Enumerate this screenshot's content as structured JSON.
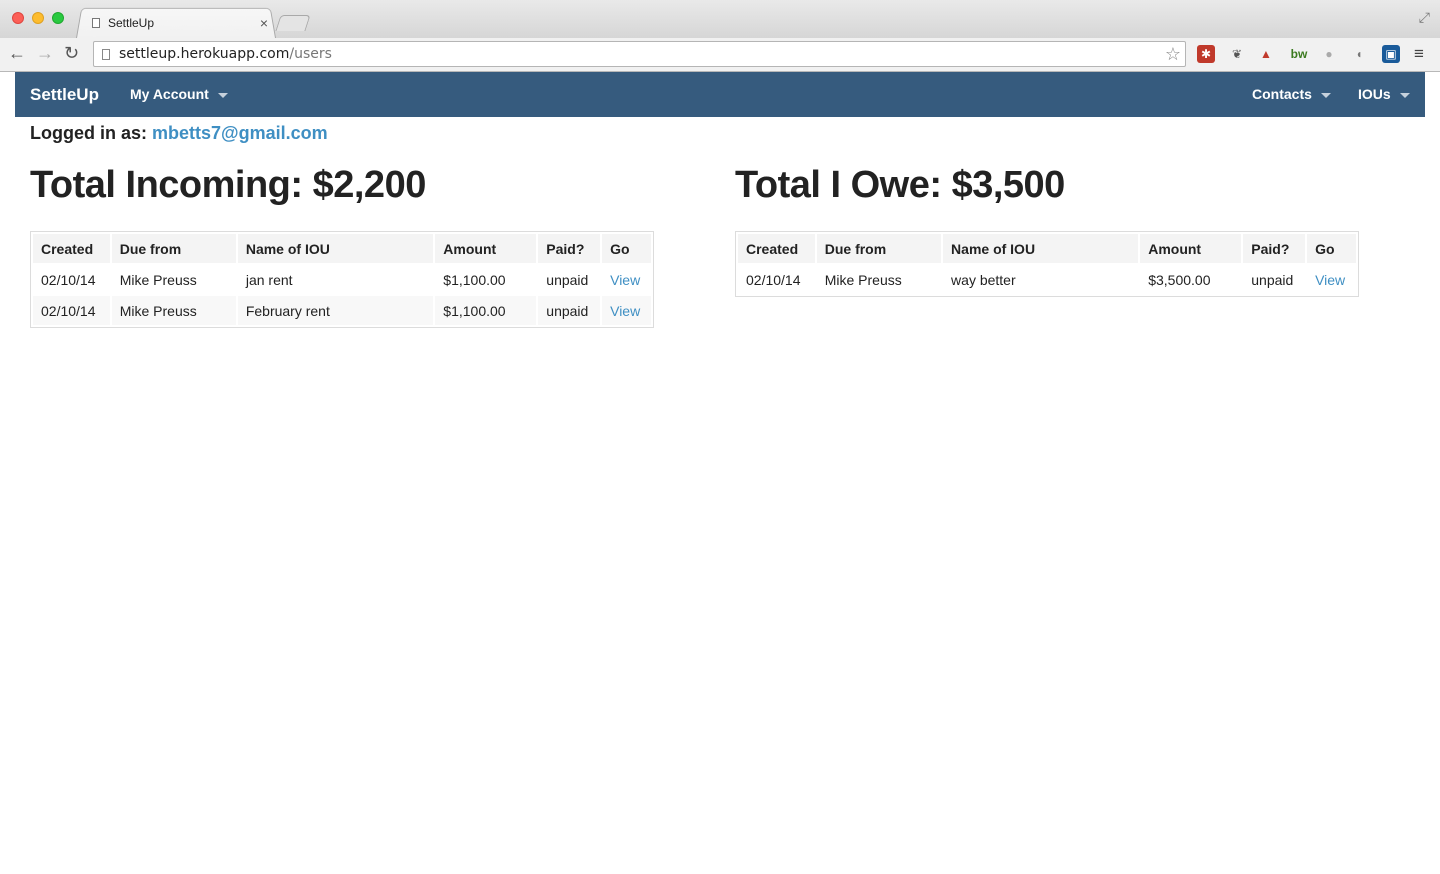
{
  "browser": {
    "tab_title": "SettleUp",
    "tab_close": "×",
    "url_host": "settleup.herokuapp.com",
    "url_path": "/users",
    "back": "←",
    "forward": "→",
    "reload": "↻",
    "star": "☆",
    "menu": "≡",
    "fullscreen": "⤢"
  },
  "navbar": {
    "brand": "SettleUp",
    "my_account": "My Account",
    "contacts": "Contacts",
    "ious": "IOUs",
    "color": "#365b7e"
  },
  "user": {
    "logged_in_label": "Logged in as:",
    "email": "mbetts7@gmail.com"
  },
  "incoming": {
    "title": "Total Incoming: $2,200",
    "headers": [
      "Created",
      "Due from",
      "Name of IOU",
      "Amount",
      "Paid?",
      "Go"
    ],
    "rows": [
      {
        "created": "02/10/14",
        "due_from": "Mike Preuss",
        "name": "jan rent",
        "amount": "$1,100.00",
        "paid": "unpaid",
        "go": "View"
      },
      {
        "created": "02/10/14",
        "due_from": "Mike Preuss",
        "name": "February rent",
        "amount": "$1,100.00",
        "paid": "unpaid",
        "go": "View"
      }
    ]
  },
  "owe": {
    "title": "Total I Owe: $3,500",
    "headers": [
      "Created",
      "Due from",
      "Name of IOU",
      "Amount",
      "Paid?",
      "Go"
    ],
    "rows": [
      {
        "created": "02/10/14",
        "due_from": "Mike Preuss",
        "name": "way better",
        "amount": "$3,500.00",
        "paid": "unpaid",
        "go": "View"
      }
    ]
  },
  "colors": {
    "link": "#3f8fc3",
    "navbar": "#365b7e"
  }
}
